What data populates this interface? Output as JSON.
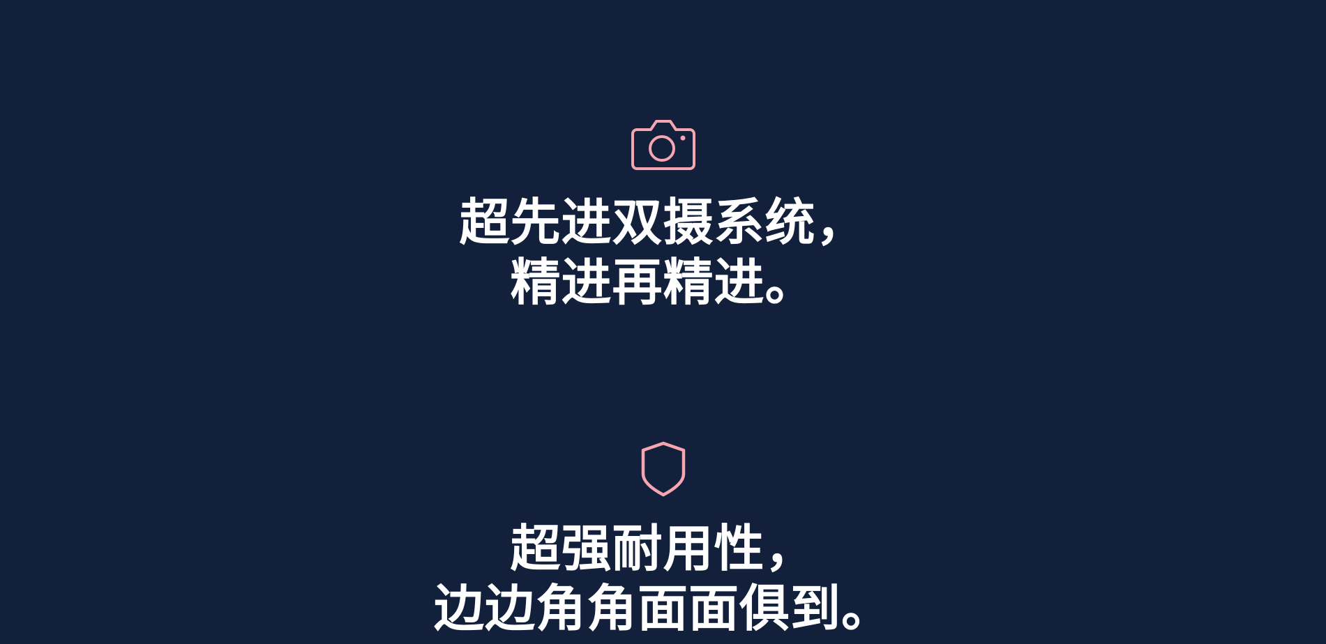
{
  "colors": {
    "background": "#13203b",
    "icon_accent": "#f4a7b0",
    "text": "#ffffff"
  },
  "features": [
    {
      "icon": "camera-icon",
      "line1": "超先进双摄系统，",
      "line2": "精进再精进。"
    },
    {
      "icon": "shield-icon",
      "line1": "超强耐用性，",
      "line2": "边边角角面面俱到。"
    }
  ]
}
